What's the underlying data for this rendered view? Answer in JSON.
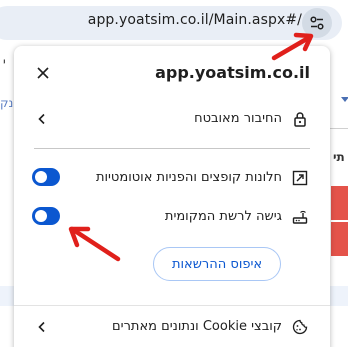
{
  "browser": {
    "url": "app.yoatsim.co.il/Main.aspx#/",
    "site_info_button": "tune-icon"
  },
  "popup": {
    "title": "app.yoatsim.co.il",
    "close_icon": "close-icon",
    "connection": {
      "label": "החיבור מאובטח",
      "icon": "lock-icon"
    },
    "popups_redirects": {
      "label": "חלונות קופצים והפניות אוטומטיות",
      "icon": "popup-window-icon",
      "enabled": true
    },
    "local_network": {
      "label": "גישה לרשת המקומית",
      "icon": "router-icon",
      "enabled": true
    },
    "reset_permissions_label": "איפוס ההרשאות",
    "cookies": {
      "label": "קובצי Cookie ונתונים מאתרים",
      "icon": "cookie-icon"
    }
  },
  "background": {
    "left_fragment_1": "י",
    "left_fragment_2": "נק",
    "right_fragment": "תי"
  },
  "colors": {
    "accent": "#0b57d0",
    "annotation_arrow": "#e0201b",
    "url_bar": "#e9eef6"
  }
}
